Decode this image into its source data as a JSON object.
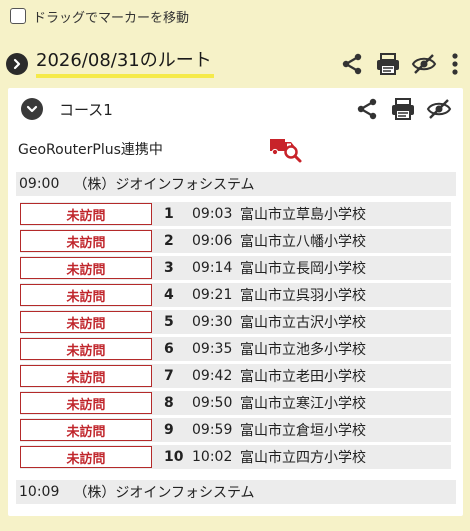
{
  "drag_toggle": {
    "label": "ドラッグでマーカーを移動",
    "checked": false
  },
  "route": {
    "title": "2026/08/31のルート"
  },
  "course": {
    "title": "コース1",
    "integration_label": "GeoRouterPlus連携中",
    "start": {
      "time": "09:00",
      "name": "（株）ジオインフォシステム"
    },
    "end": {
      "time": "10:09",
      "name": "（株）ジオインフォシステム"
    },
    "visits": [
      {
        "status": "未訪問",
        "num": "1",
        "time": "09:03",
        "name": "富山市立草島小学校"
      },
      {
        "status": "未訪問",
        "num": "2",
        "time": "09:06",
        "name": "富山市立八幡小学校"
      },
      {
        "status": "未訪問",
        "num": "3",
        "time": "09:14",
        "name": "富山市立長岡小学校"
      },
      {
        "status": "未訪問",
        "num": "4",
        "time": "09:21",
        "name": "富山市立呉羽小学校"
      },
      {
        "status": "未訪問",
        "num": "5",
        "time": "09:30",
        "name": "富山市立古沢小学校"
      },
      {
        "status": "未訪問",
        "num": "6",
        "time": "09:35",
        "name": "富山市立池多小学校"
      },
      {
        "status": "未訪問",
        "num": "7",
        "time": "09:42",
        "name": "富山市立老田小学校"
      },
      {
        "status": "未訪問",
        "num": "8",
        "time": "09:50",
        "name": "富山市立寒江小学校"
      },
      {
        "status": "未訪問",
        "num": "9",
        "time": "09:59",
        "name": "富山市立倉垣小学校"
      },
      {
        "status": "未訪問",
        "num": "10",
        "time": "10:02",
        "name": "富山市立四方小学校"
      }
    ]
  },
  "icons": {
    "share": "share-icon",
    "print": "print-icon",
    "visibility": "eye-off-icon",
    "more": "more-vertical-icon",
    "geo": "truck-search-icon"
  },
  "colors": {
    "background": "#f6f2c8",
    "title_highlight": "#f5ea4a",
    "status_red": "#c0262c",
    "row_gray": "#ececec"
  }
}
